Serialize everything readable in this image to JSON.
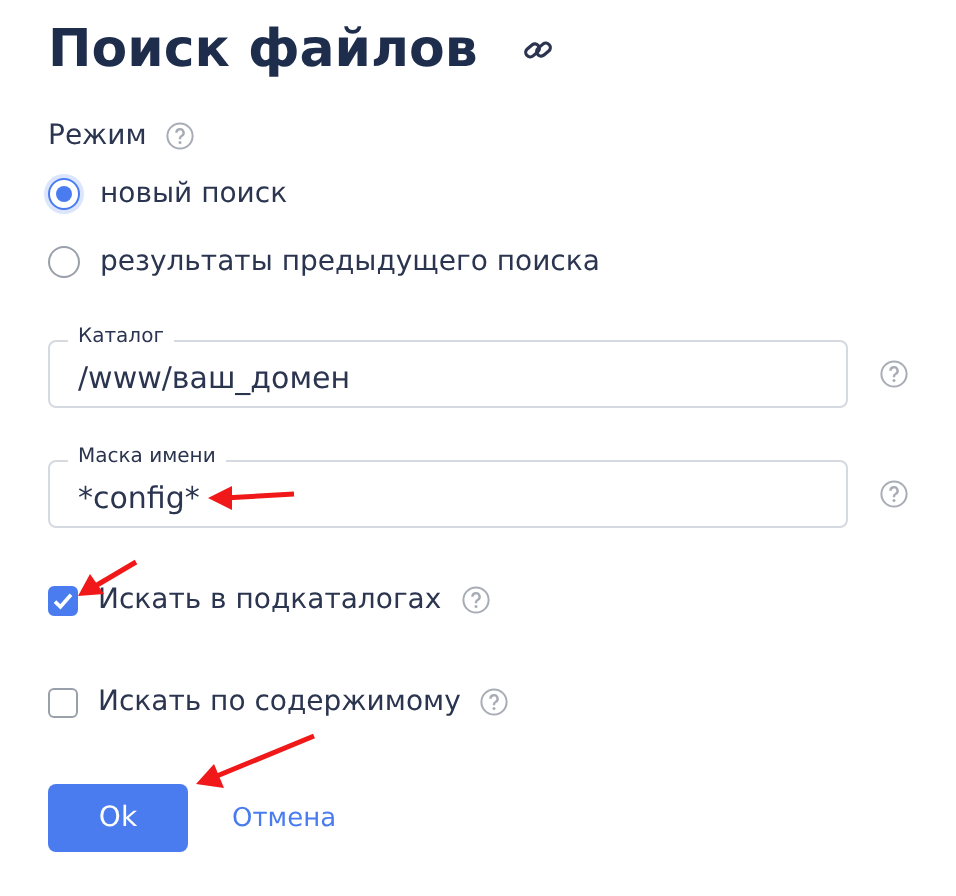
{
  "title": "Поиск файлов",
  "mode": {
    "label": "Режим",
    "options": [
      {
        "label": "новый поиск",
        "selected": true
      },
      {
        "label": "результаты предыдущего поиска",
        "selected": false
      }
    ]
  },
  "fields": [
    {
      "label": "Каталог",
      "value": "/www/ваш_домен"
    },
    {
      "label": "Маска имени",
      "value": "*config*"
    }
  ],
  "checkboxes": [
    {
      "label": "Искать в подкаталогах",
      "checked": true
    },
    {
      "label": "Искать по содержимому",
      "checked": false
    }
  ],
  "buttons": [
    {
      "label": "Ok",
      "kind": "primary"
    },
    {
      "label": "Отмена",
      "kind": "link"
    }
  ]
}
